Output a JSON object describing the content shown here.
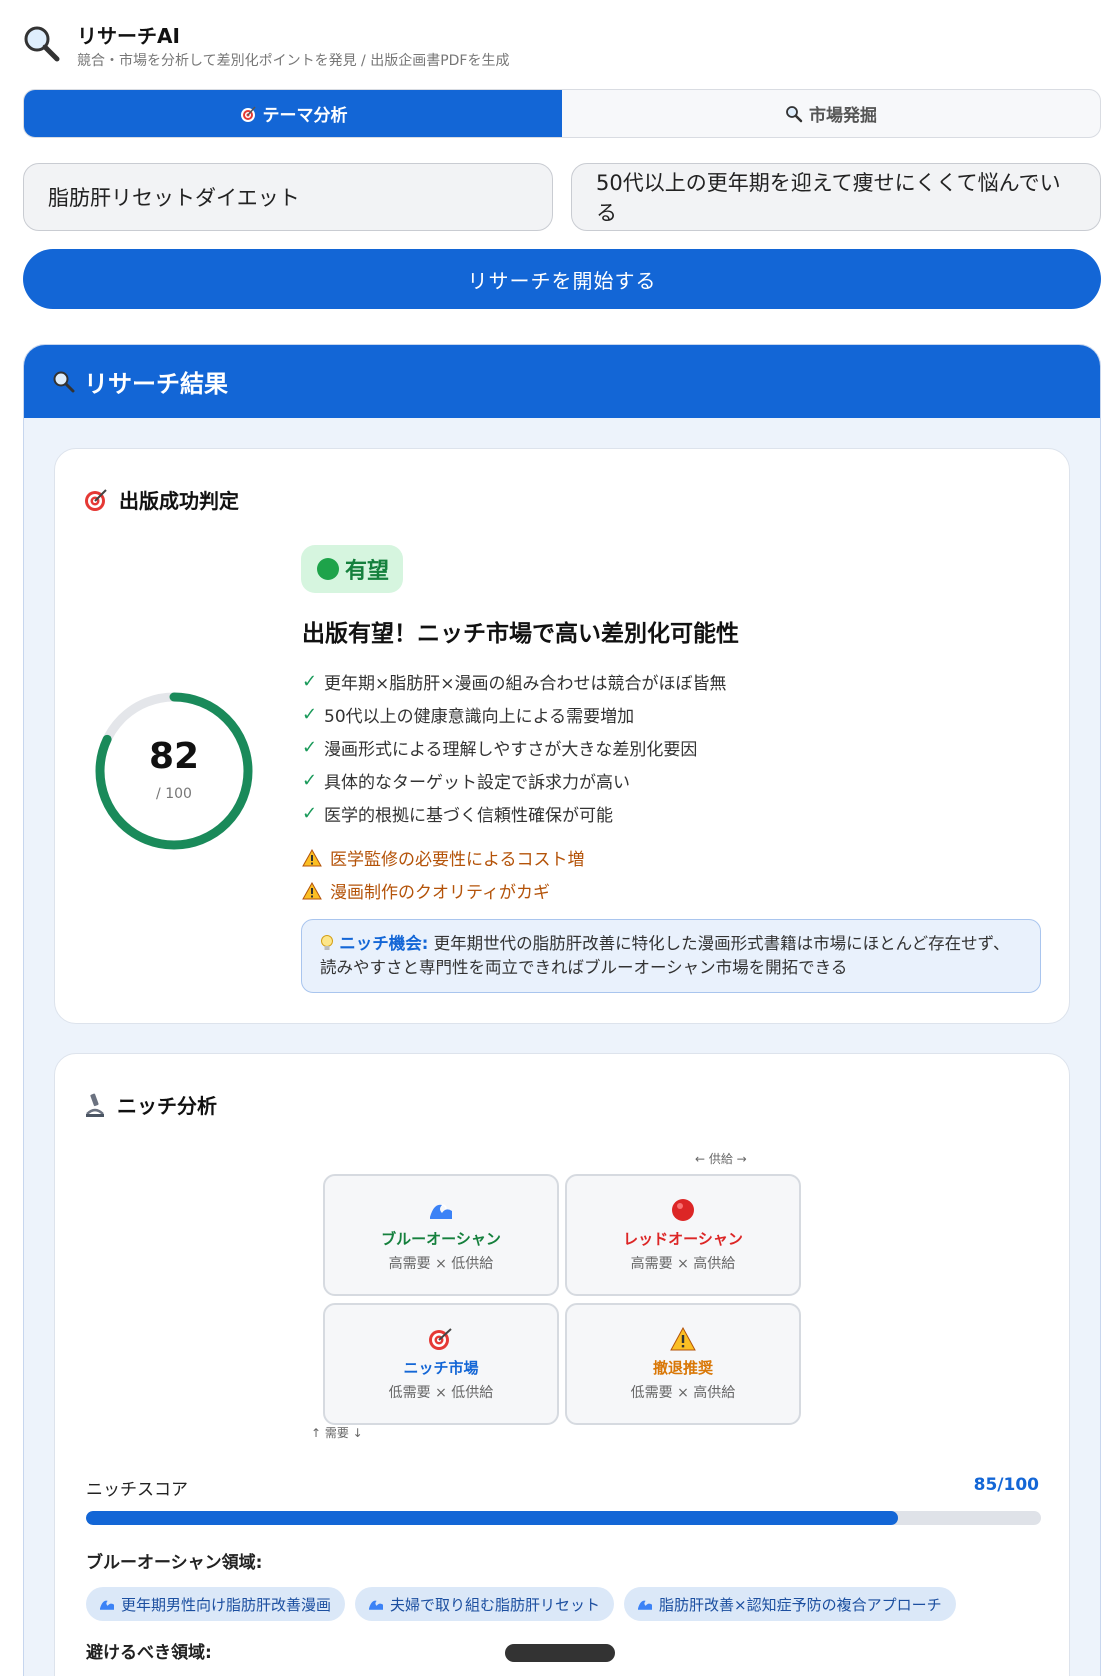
{
  "app": {
    "title": "リサーチAI",
    "subtitle": "競合・市場を分析して差別化ポイントを発見 / 出版企画書PDFを生成"
  },
  "tabs": [
    {
      "label": "テーマ分析",
      "active": true
    },
    {
      "label": "市場発掘",
      "active": false
    }
  ],
  "inputs": {
    "theme": "脂肪肝リセットダイエット",
    "target": "50代以上の更年期を迎えて痩せにくくて悩んでいる"
  },
  "start_button": "リサーチを開始する",
  "results": {
    "header": "リサーチ結果",
    "success": {
      "title": "出版成功判定",
      "score": 82,
      "score_max": "/ 100",
      "badge": "有望",
      "headline": "出版有望！ニッチ市場で高い差別化可能性",
      "positives": [
        "更年期×脂肪肝×漫画の組み合わせは競合がほぼ皆無",
        "50代以上の健康意識向上による需要増加",
        "漫画形式による理解しやすさが大きな差別化要因",
        "具体的なターゲット設定で訴求力が高い",
        "医学的根拠に基づく信頼性確保が可能"
      ],
      "warnings": [
        "医学監修の必要性によるコスト増",
        "漫画制作のクオリティがカギ"
      ],
      "niche_label": "ニッチ機会:",
      "niche_text": "更年期世代の脂肪肝改善に特化した漫画形式書籍は市場にほとんど存在せず、読みやすさと専門性を両立できればブルーオーシャン市場を開拓できる"
    },
    "niche": {
      "title": "ニッチ分析",
      "supply_axis": "← 供給 →",
      "demand_axis": "↑ 需要 ↓",
      "quadrants": [
        {
          "name": "ブルーオーシャン",
          "desc": "高需要 × 低供給",
          "icon": "wave-icon"
        },
        {
          "name": "レッドオーシャン",
          "desc": "高需要 × 高供給",
          "icon": "red-circle-icon"
        },
        {
          "name": "ニッチ市場",
          "desc": "低需要 × 低供給",
          "icon": "target-icon"
        },
        {
          "name": "撤退推奨",
          "desc": "低需要 × 高供給",
          "icon": "warning-icon"
        }
      ],
      "score_label": "ニッチスコア",
      "score_text": "85/100",
      "score_value": 85,
      "blue_label": "ブルーオーシャン領域:",
      "blue_chips": [
        "更年期男性向け脂肪肝改善漫画",
        "夫婦で取り組む脂肪肝リセット",
        "脂肪肝改善×認知症予防の複合アプローチ"
      ],
      "avoid_label": "避けるべき領域:"
    }
  },
  "colors": {
    "accent": "#1366d6",
    "success": "#1a8a5a",
    "warning": "#b45309"
  }
}
